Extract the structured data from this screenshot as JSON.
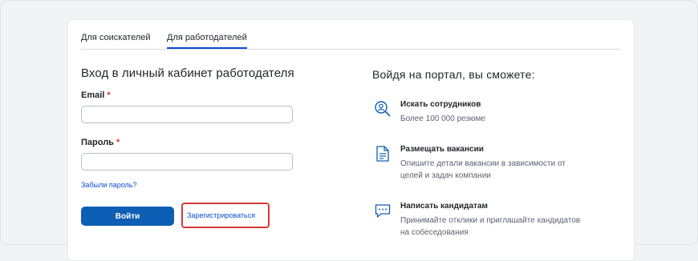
{
  "tabs": [
    {
      "label": "Для соискателей",
      "active": false
    },
    {
      "label": "Для работодателей",
      "active": true
    }
  ],
  "login": {
    "title": "Вход в личный кабинет работодателя",
    "email_label": "Email",
    "email_value": "",
    "password_label": "Пароль",
    "password_value": "",
    "required_marker": "*",
    "forgot_link": "Забыли пароль?",
    "login_button": "Войти",
    "register_button": "Зарегистрироваться"
  },
  "promo": {
    "title": "Войдя на портал, вы сможете:",
    "features": [
      {
        "icon": "search-people-icon",
        "title": "Искать сотрудников",
        "desc": "Более 100 000 резюме"
      },
      {
        "icon": "document-icon",
        "title": "Размещать вакансии",
        "desc": "Опишите детали вакансии в зависимости от целей и задач компании"
      },
      {
        "icon": "chat-icon",
        "title": "Написать кандидатам",
        "desc": "Принимайте отклики и приглашайте кандидатов на собеседования"
      }
    ]
  },
  "colors": {
    "accent": "#0d4cd3",
    "primary_button": "#0d5eb5",
    "highlight_border": "#d93a34",
    "required": "#e0312b"
  }
}
